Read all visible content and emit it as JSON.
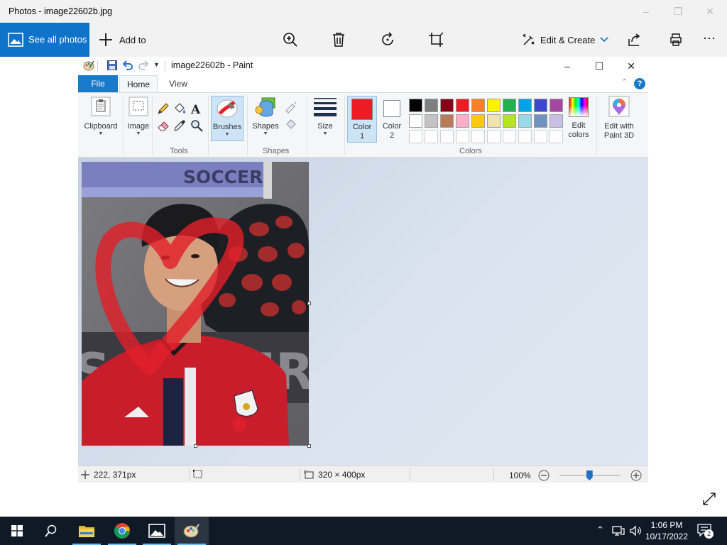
{
  "photos": {
    "window_title": "Photos - image22602b.jpg",
    "see_all_label": "See all photos",
    "add_to_label": "Add to",
    "edit_create_label": "Edit & Create"
  },
  "paint": {
    "window_title": "image22602b - Paint",
    "tabs": {
      "file": "File",
      "home": "Home",
      "view": "View"
    },
    "help_label": "?",
    "ribbon": {
      "clipboard": "Clipboard",
      "image": "Image",
      "tools_group": "Tools",
      "brushes": "Brushes",
      "shapes": "Shapes",
      "shapes_group": "Shapes",
      "size": "Size",
      "color1_line1": "Color",
      "color1_line2": "1",
      "color2_line1": "Color",
      "color2_line2": "2",
      "colors_group": "Colors",
      "edit_colors_line1": "Edit",
      "edit_colors_line2": "colors",
      "paint3d_line1": "Edit with",
      "paint3d_line2": "Paint 3D"
    },
    "palette_row1": [
      "#000000",
      "#7f7f7f",
      "#880015",
      "#ed1c24",
      "#ff7f27",
      "#fff200",
      "#22b14c",
      "#00a2e8",
      "#3f48cc",
      "#a349a4"
    ],
    "palette_row2": [
      "#ffffff",
      "#c3c3c3",
      "#b97a57",
      "#ffaec9",
      "#ffc90e",
      "#efe4b0",
      "#b5e61d",
      "#99d9ea",
      "#7092be",
      "#c8bfe7"
    ],
    "color1": "#ed1c24",
    "color2": "#ffffff",
    "canvas_text": "SOCCER",
    "status": {
      "cursor_pos": "222, 371px",
      "image_size": "320 × 400px",
      "zoom": "100%"
    }
  },
  "taskbar": {
    "time": "1:06 PM",
    "date": "10/17/2022",
    "notification_count": "2"
  }
}
